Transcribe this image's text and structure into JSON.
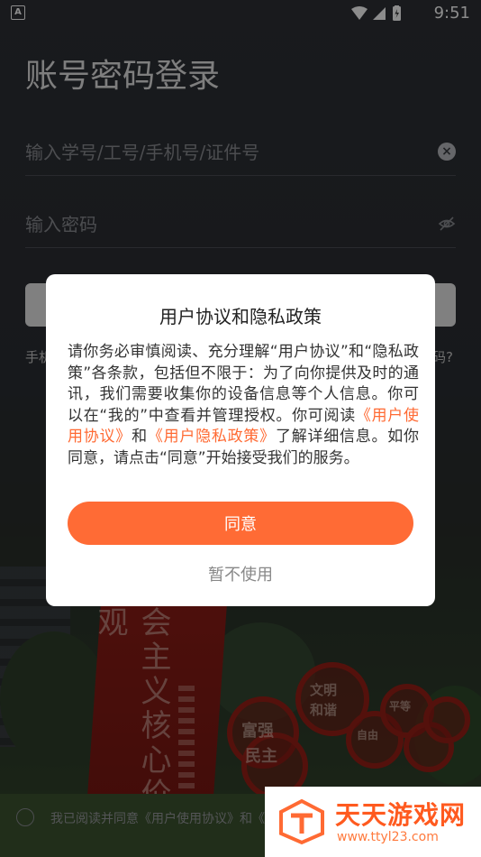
{
  "status_bar": {
    "app_badge": "A",
    "time": "9:51",
    "icons": [
      "wifi-icon",
      "signal-icon",
      "battery-icon"
    ]
  },
  "login": {
    "title": "账号密码登录",
    "account_placeholder": "输入学号/工号/手机号/证件号",
    "password_placeholder": "输入密码",
    "help_left_partial": "手机",
    "help_right_partial": "码?"
  },
  "dialog": {
    "title": "用户协议和隐私政策",
    "body_part1": "请你务必审慎阅读、充分理解“用户协议”和“隐私政策”各条款，包括但不限于：为了向你提供及时的通讯，我们需要收集你的设备信息等个人信息。你可以在“我的”中查看并管理授权。你可阅读",
    "link_user_agreement": "《用户使用协议》",
    "body_and": "和",
    "link_privacy": "《用户隐私政策》",
    "body_part2": "了解详细信息。如你同意，请点击“同意”开始接受我们的服务。",
    "agree_label": "同意",
    "skip_label": "暂不使用"
  },
  "consent": {
    "text": "我已阅读并同意《用户使用协议》和《"
  },
  "background": {
    "banner_text": "会主义核心价值观",
    "sign_chars": [
      "富强",
      "民主",
      "文明",
      "和谐",
      "自由",
      "平等"
    ]
  },
  "watermark": {
    "title": "天天游戏网",
    "url": "www.ttyl23.com"
  },
  "colors": {
    "accent": "#ff6b35",
    "link": "#ff6a33",
    "overlay": "rgba(0,0,0,0.45)"
  }
}
